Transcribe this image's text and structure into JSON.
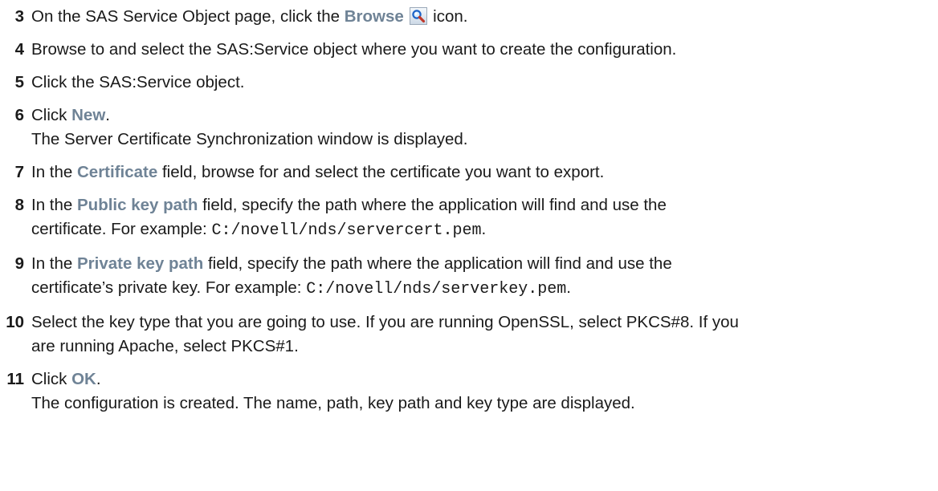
{
  "steps": [
    {
      "number": "3",
      "pre": "On the SAS Service Object page, click the ",
      "ui": "Browse",
      "icon": "browse-magnifier-icon",
      "post": " icon."
    },
    {
      "number": "4",
      "text": "Browse to and select the SAS:Service object where you want to create the configuration."
    },
    {
      "number": "5",
      "text": "Click the SAS:Service object."
    },
    {
      "number": "6",
      "pre": "Click ",
      "ui": "New",
      "post": ".",
      "note": "The Server Certificate Synchronization window is displayed."
    },
    {
      "number": "7",
      "pre": "In the ",
      "ui": "Certificate",
      "post": " field, browse for and select the certificate you want to export."
    },
    {
      "number": "8",
      "pre": "In the ",
      "ui": "Public key path",
      "post": " field, specify the path where the application will find and use the",
      "line2_pre": "certificate. For example: ",
      "code": "C:/novell/nds/servercert.pem",
      "line2_post": "."
    },
    {
      "number": "9",
      "pre": "In the ",
      "ui": "Private key path",
      "post": " field, specify the path where the application will find and use the",
      "line2_pre": "certificate’s private key. For example: ",
      "code": "C:/novell/nds/serverkey.pem",
      "line2_post": "."
    },
    {
      "number": "10",
      "line1": "Select the key type that you are going to use. If you are running OpenSSL, select PKCS#8. If you",
      "line2": "are running Apache, select PKCS#1."
    },
    {
      "number": "11",
      "pre": "Click ",
      "ui": "OK",
      "post": ".",
      "note": "The configuration is created. The name, path, key path and key type are displayed."
    }
  ]
}
